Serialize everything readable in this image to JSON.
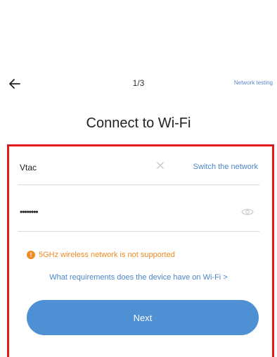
{
  "header": {
    "step": "1/3",
    "network_link": "Network testing",
    "back_icon": "arrow-left-icon"
  },
  "title": "Connect to Wi-Fi",
  "ssid_field": {
    "value": "Vtac",
    "clear_icon": "close-icon",
    "switch_label": "Switch the network"
  },
  "password_field": {
    "value": "••••••••",
    "eye_icon": "eye-icon"
  },
  "warning": {
    "icon": "exclamation-circle-icon",
    "text": "5GHz wireless network is not supported"
  },
  "requirements_link": "What requirements does the device have on Wi-Fi >",
  "next_label": "Next",
  "colors": {
    "accent": "#4f8fd4",
    "link": "#4a86c8",
    "warning": "#f08a24",
    "highlight_border": "#e01a1a"
  }
}
